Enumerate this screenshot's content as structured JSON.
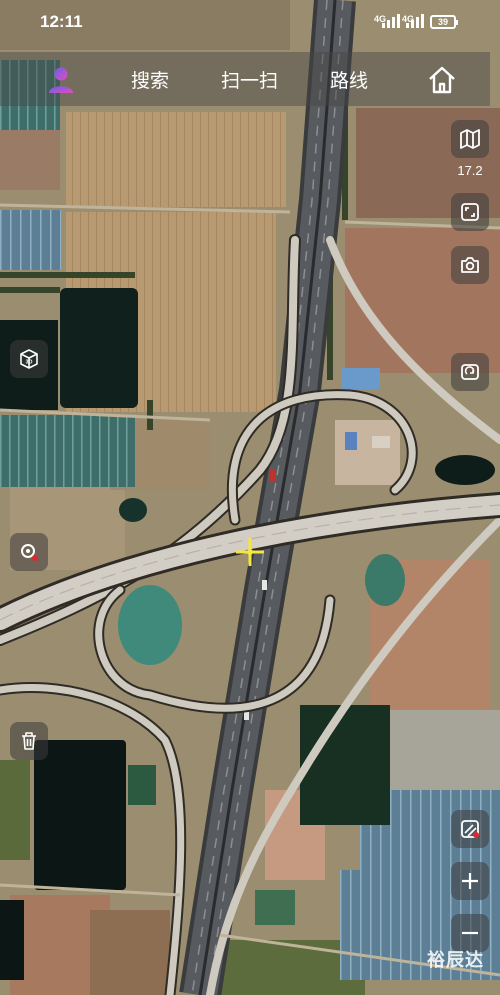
{
  "status_bar": {
    "time": "12:11",
    "signal_1": "4G",
    "signal_2": "4G",
    "battery": "39"
  },
  "top_nav": {
    "search_label": "搜索",
    "scan_label": "扫一扫",
    "route_label": "路线"
  },
  "map": {
    "zoom_level": "17.2",
    "view_type": "satellite",
    "marker_color": "#f5e642"
  },
  "tools": {
    "right": [
      "map-icon",
      "fullscreen-icon",
      "camera-icon",
      "rotate-icon",
      "eraser-icon",
      "zoom-in-icon",
      "zoom-out-icon"
    ],
    "left": [
      "3d-icon",
      "location-icon",
      "trash-icon"
    ]
  },
  "watermark": {
    "text": "裕辰达"
  },
  "colors": {
    "accent": "#e0262f",
    "avatar": "#b84ae0",
    "ui_icon": "#ffffff"
  }
}
